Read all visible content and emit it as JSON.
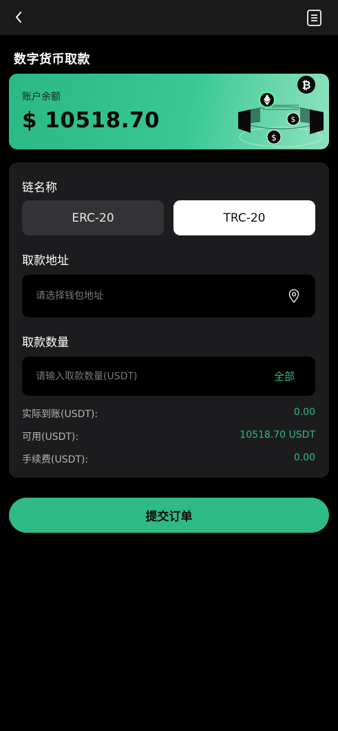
{
  "header": {
    "back_icon": "chevron-left-icon",
    "records_icon": "document-list-icon"
  },
  "page": {
    "title": "数字货币取款"
  },
  "balance": {
    "label": "账户余额",
    "amount": "$ 10518.70"
  },
  "form": {
    "chain_label": "链名称",
    "chains": [
      {
        "label": "ERC-20",
        "selected": false
      },
      {
        "label": "TRC-20",
        "selected": true
      }
    ],
    "address_label": "取款地址",
    "address_placeholder": "请选择钱包地址",
    "address_icon": "location-pin-icon",
    "amount_label": "取款数量",
    "amount_placeholder": "请输入取款数量(USDT)",
    "all_label": "全部",
    "details": [
      {
        "key": "实际到账(USDT):",
        "value": "0.00"
      },
      {
        "key": "可用(USDT):",
        "value": "10518.70 USDT"
      },
      {
        "key": "手续费(USDT):",
        "value": "0.00"
      }
    ]
  },
  "submit_label": "提交订单",
  "colors": {
    "accent": "#2fba86",
    "background": "#000000",
    "card": "#1c1c1e"
  }
}
